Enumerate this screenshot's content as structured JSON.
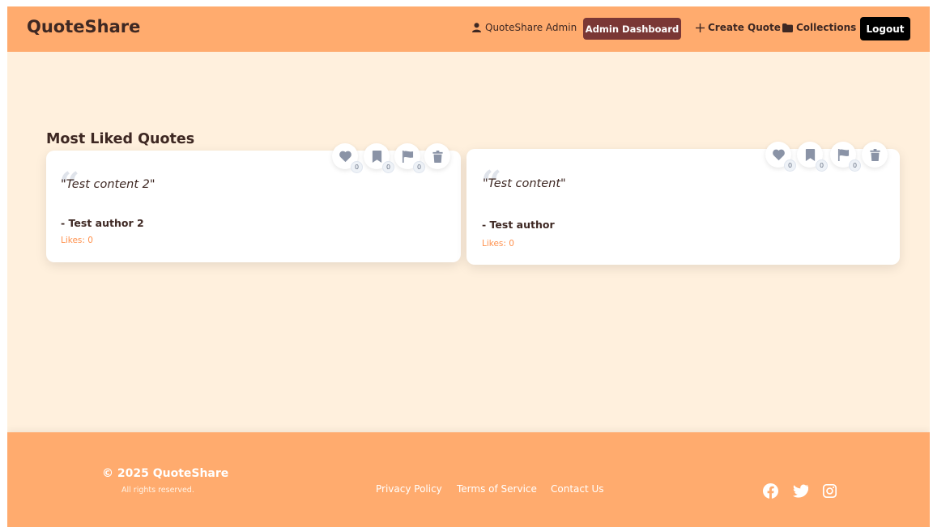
{
  "header": {
    "brand": "QuoteShare",
    "user_label": "QuoteShare Admin",
    "admin_button": "Admin Dashboard",
    "create_quote": "Create Quote",
    "collections": "Collections",
    "logout": "Logout"
  },
  "main": {
    "section_title": "Most Liked Quotes",
    "quotes": [
      {
        "text": "\"Test content 2\"",
        "author": "- Test author 2",
        "likes": "Likes: 0",
        "like_count": "0",
        "save_count": "0",
        "flag_count": "0"
      },
      {
        "text": "\"Test content\"",
        "author": "- Test author",
        "likes": "Likes: 0",
        "like_count": "0",
        "save_count": "0",
        "flag_count": "0"
      }
    ]
  },
  "footer": {
    "copyright": "© 2025 QuoteShare",
    "rights": "All rights reserved.",
    "links": [
      "Privacy Policy",
      "Terms of Service",
      "Contact Us"
    ],
    "social_icons": [
      "facebook-icon",
      "twitter-icon",
      "instagram-icon"
    ]
  },
  "colors": {
    "header_bg": "#ffab6e",
    "page_bg": "#fff0dd",
    "admin_button_bg": "#7a3735",
    "logout_bg": "#000000",
    "likes_text": "#ff914d"
  }
}
